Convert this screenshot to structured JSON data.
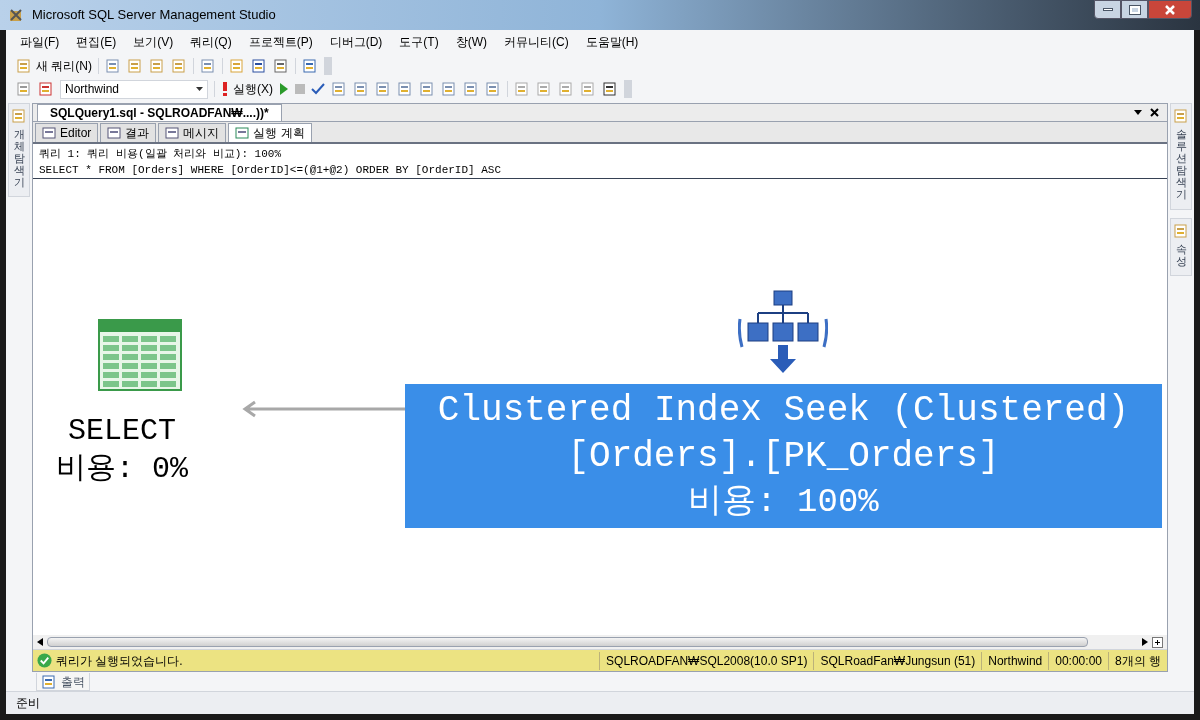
{
  "window": {
    "title": "Microsoft SQL Server Management Studio"
  },
  "menu": [
    "파일(F)",
    "편집(E)",
    "보기(V)",
    "쿼리(Q)",
    "프로젝트(P)",
    "디버그(D)",
    "도구(T)",
    "창(W)",
    "커뮤니티(C)",
    "도움말(H)"
  ],
  "toolbar": {
    "new_query": "새 쿼리(N)",
    "database": "Northwind",
    "execute": "실행(X)"
  },
  "left_panel": {
    "label": "개체 탐색기"
  },
  "right_panels": [
    {
      "label": "솔루션 탐색기"
    },
    {
      "label": "속성"
    }
  ],
  "document_tab": {
    "title": "SQLQuery1.sql - SQLROADFAN₩....))*"
  },
  "result_tabs": [
    {
      "label": "Editor",
      "selected": false
    },
    {
      "label": "결과",
      "selected": false
    },
    {
      "label": "메시지",
      "selected": false
    },
    {
      "label": "실행 계획",
      "selected": true
    }
  ],
  "plan_header": [
    "쿼리 1: 쿼리 비용(일괄 처리와 비교): 100%",
    "SELECT * FROM [Orders] WHERE [OrderID]<=(@1+@2) ORDER BY [OrderID] ASC"
  ],
  "operators": [
    {
      "kind": "select",
      "name": "SELECT",
      "cost": "비용: 0%",
      "selected": false
    },
    {
      "kind": "index_seek",
      "name": "Clustered Index Seek (Clustered)",
      "object": "[Orders].[PK_Orders]",
      "cost": "비용: 100%",
      "selected": true
    }
  ],
  "status": {
    "message": "쿼리가 실행되었습니다.",
    "segments": [
      "SQLROADFAN₩SQL2008(10.0 SP1)",
      "SQLRoadFan₩Jungsun (51)",
      "Northwind",
      "00:00:00",
      "8개의 행"
    ]
  },
  "output_tab": {
    "label": "출력"
  },
  "status_bar": {
    "text": "준비"
  }
}
